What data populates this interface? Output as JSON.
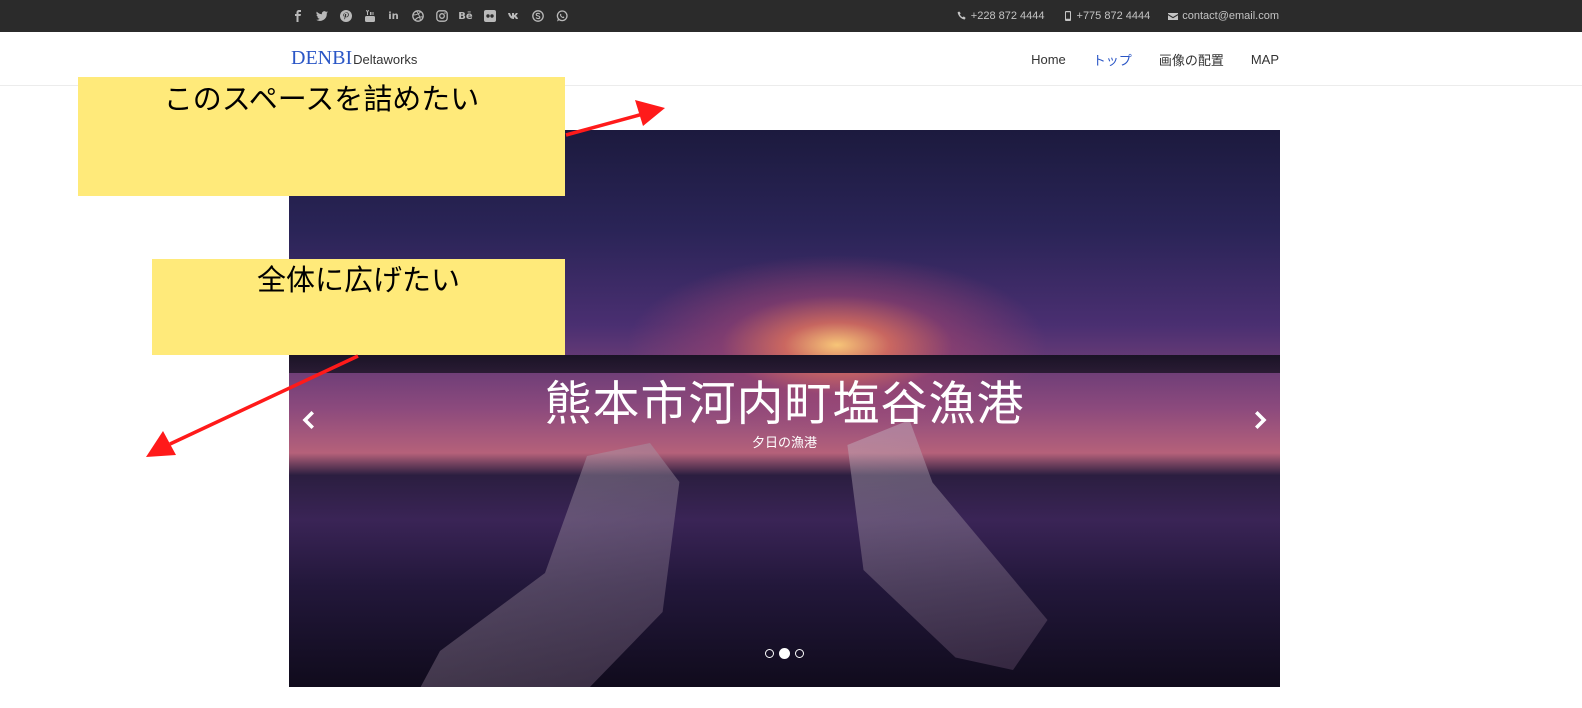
{
  "topbar": {
    "social_icons": [
      "facebook-icon",
      "twitter-icon",
      "pinterest-icon",
      "youtube-icon",
      "linkedin-icon",
      "dribbble-icon",
      "instagram-icon",
      "behance-icon",
      "flickr-icon",
      "vk-icon",
      "skype-icon",
      "whatsapp-icon"
    ],
    "behance_text": "Bē",
    "linkedin_text": "in",
    "phone1": "+228 872 4444",
    "phone2": "+775 872 4444",
    "email": "contact@email.com"
  },
  "nav": {
    "brand_main": "DENBI",
    "brand_sub": "Deltaworks",
    "items": [
      {
        "label": "Home"
      },
      {
        "label": "トップ"
      },
      {
        "label": "画像の配置"
      },
      {
        "label": "MAP"
      }
    ],
    "active_index": 1
  },
  "hero": {
    "title": "熊本市河内町塩谷漁港",
    "subtitle": "夕日の漁港",
    "slide_count": 3,
    "active_slide": 1
  },
  "notes": {
    "note1": "このスペースを詰めたい",
    "note2": "全体に広げたい"
  },
  "colors": {
    "accent": "#2a56c6",
    "topbar_bg": "#2b2b2b",
    "note_bg": "#ffea7a",
    "annotation_arrow": "#ff1a1a"
  }
}
